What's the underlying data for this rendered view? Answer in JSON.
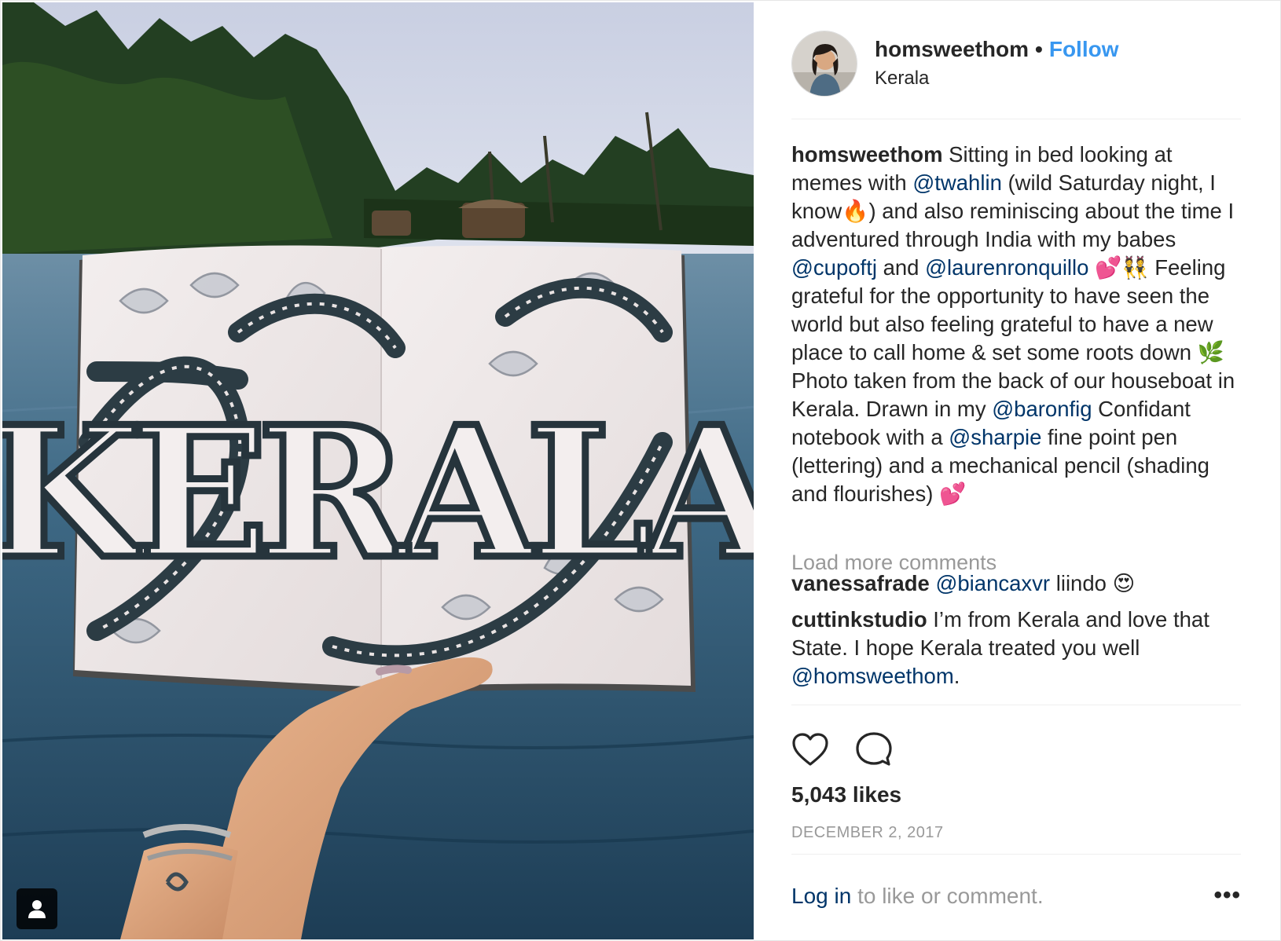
{
  "post": {
    "username": "homsweethom",
    "separator": "•",
    "follow_label": "Follow",
    "location": "Kerala",
    "artwork_text": "KERALA",
    "caption": {
      "username": "homsweethom",
      "parts": [
        {
          "text": "Sitting in bed looking at memes with "
        },
        {
          "text": "@twahlin",
          "mention": true
        },
        {
          "text": " (wild Saturday night, I know🔥) and also reminiscing about the time I adventured through India with my babes "
        },
        {
          "text": "@cupoftj",
          "mention": true
        },
        {
          "text": " and "
        },
        {
          "text": "@laurenronquillo",
          "mention": true
        },
        {
          "text": " 💕👯 Feeling grateful for the opportunity to have seen the world but also feeling grateful to have a new place to call home & set some roots down 🌿 Photo taken from the back of our houseboat in Kerala. Drawn in my "
        },
        {
          "text": "@baronfig",
          "mention": true
        },
        {
          "text": " Confidant notebook with a "
        },
        {
          "text": "@sharpie",
          "mention": true
        },
        {
          "text": " fine point pen (lettering) and a mechanical pencil (shading and flourishes) 💕"
        }
      ]
    },
    "load_more_label": "Load more comments",
    "comments": [
      {
        "username": "vanessafrade",
        "parts": [
          {
            "text": "@biancaxvr",
            "mention": true
          },
          {
            "text": " liindo 😍"
          }
        ]
      },
      {
        "username": "cuttinkstudio",
        "parts": [
          {
            "text": "I’m from Kerala and love that State. I hope Kerala treated you well "
          },
          {
            "text": "@homsweethom",
            "mention": true
          },
          {
            "text": "."
          }
        ]
      }
    ],
    "likes_label": "5,043 likes",
    "date": "DECEMBER 2, 2017",
    "login_link": "Log in",
    "login_suffix": " to like or comment.",
    "more_label": "•••",
    "icons": {
      "like": "heart-outline-icon",
      "comment": "speech-bubble-icon",
      "tag": "person-tag-icon",
      "more": "ellipsis-icon"
    },
    "colors": {
      "link_blue": "#3897f0",
      "mention_blue": "#003569",
      "muted_gray": "#999999",
      "text": "#262626"
    }
  }
}
